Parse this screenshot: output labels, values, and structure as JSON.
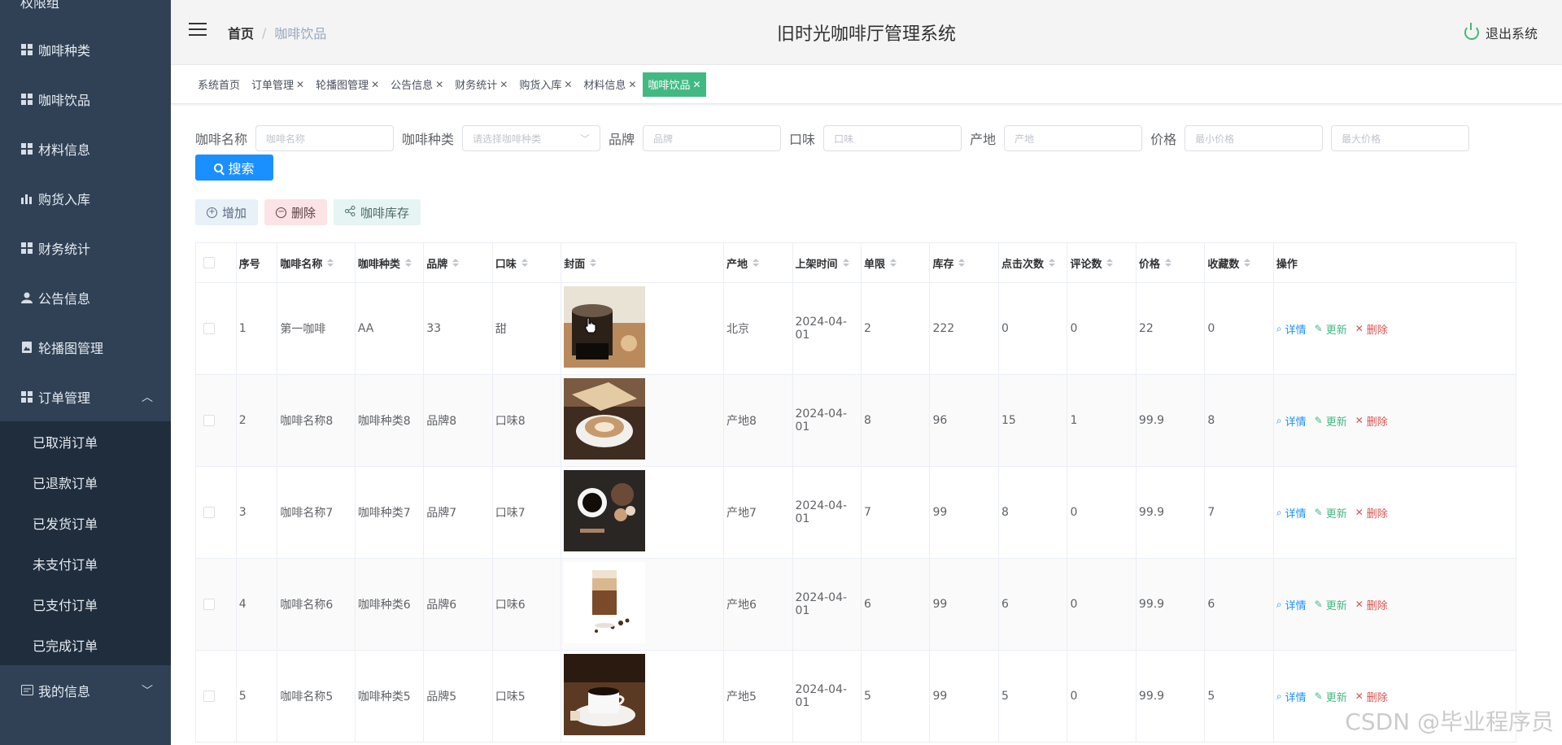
{
  "sidebar": {
    "top_partial": "权限组",
    "items": [
      {
        "label": "咖啡种类",
        "icon": "grid-icon"
      },
      {
        "label": "咖啡饮品",
        "icon": "grid-icon"
      },
      {
        "label": "材料信息",
        "icon": "grid-icon"
      },
      {
        "label": "购货入库",
        "icon": "bar-chart-icon"
      },
      {
        "label": "财务统计",
        "icon": "grid-icon"
      },
      {
        "label": "公告信息",
        "icon": "user-icon"
      },
      {
        "label": "轮播图管理",
        "icon": "image-icon"
      },
      {
        "label": "订单管理",
        "icon": "grid-icon"
      }
    ],
    "order_sub": [
      "已取消订单",
      "已退款订单",
      "已发货订单",
      "未支付订单",
      "已支付订单",
      "已完成订单"
    ],
    "my_info": "我的信息"
  },
  "header": {
    "breadcrumb_home": "首页",
    "breadcrumb_current": "咖啡饮品",
    "title": "旧时光咖啡厅管理系统",
    "logout": "退出系统"
  },
  "tags": [
    {
      "label": "系统首页",
      "closable": false
    },
    {
      "label": "订单管理",
      "closable": true
    },
    {
      "label": "轮播图管理",
      "closable": true
    },
    {
      "label": "公告信息",
      "closable": true
    },
    {
      "label": "财务统计",
      "closable": true
    },
    {
      "label": "购货入库",
      "closable": true
    },
    {
      "label": "材料信息",
      "closable": true
    },
    {
      "label": "咖啡饮品",
      "closable": true,
      "active": true
    }
  ],
  "search": {
    "name_label": "咖啡名称",
    "name_placeholder": "咖啡名称",
    "type_label": "咖啡种类",
    "type_placeholder": "请选择咖啡种类",
    "brand_label": "品牌",
    "brand_placeholder": "品牌",
    "taste_label": "口味",
    "taste_placeholder": "口味",
    "origin_label": "产地",
    "origin_placeholder": "产地",
    "price_label": "价格",
    "min_price_placeholder": "最小价格",
    "max_price_placeholder": "最大价格",
    "search_button": "搜索"
  },
  "actions": {
    "add": "增加",
    "delete": "删除",
    "stock": "咖啡库存"
  },
  "table": {
    "headers": [
      "序号",
      "咖啡名称",
      "咖啡种类",
      "品牌",
      "口味",
      "封面",
      "产地",
      "上架时间",
      "单限",
      "库存",
      "点击次数",
      "评论数",
      "价格",
      "收藏数",
      "操作"
    ],
    "ops": {
      "detail": "详情",
      "update": "更新",
      "delete": "删除"
    },
    "rows": [
      [
        "1",
        "第一咖啡",
        "AA",
        "33",
        "甜",
        "",
        "北京",
        "2024-04-01",
        "2",
        "222",
        "0",
        "0",
        "22",
        "0"
      ],
      [
        "2",
        "咖啡名称8",
        "咖啡种类8",
        "品牌8",
        "口味8",
        "",
        "产地8",
        "2024-04-01",
        "8",
        "96",
        "15",
        "1",
        "99.9",
        "8"
      ],
      [
        "3",
        "咖啡名称7",
        "咖啡种类7",
        "品牌7",
        "口味7",
        "",
        "产地7",
        "2024-04-01",
        "7",
        "99",
        "8",
        "0",
        "99.9",
        "7"
      ],
      [
        "4",
        "咖啡名称6",
        "咖啡种类6",
        "品牌6",
        "口味6",
        "",
        "产地6",
        "2024-04-01",
        "6",
        "99",
        "6",
        "0",
        "99.9",
        "6"
      ],
      [
        "5",
        "咖啡名称5",
        "咖啡种类5",
        "品牌5",
        "口味5",
        "",
        "产地5",
        "2024-04-01",
        "5",
        "99",
        "5",
        "0",
        "99.9",
        "5"
      ]
    ]
  },
  "watermark": "CSDN @毕业程序员",
  "colors": {
    "sidebar_bg": "#304156",
    "submenu_bg": "#1f2d3d",
    "accent_green": "#42b983",
    "primary_blue": "#1a90ff"
  }
}
